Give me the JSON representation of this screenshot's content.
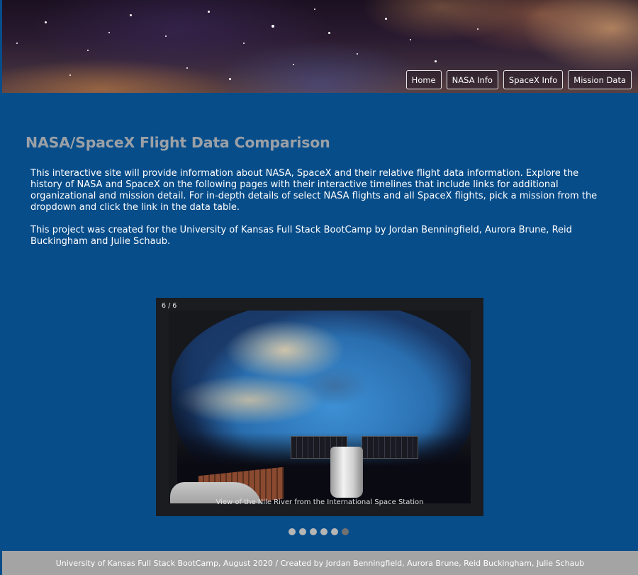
{
  "nav": {
    "items": [
      {
        "label": "Home"
      },
      {
        "label": "NASA Info"
      },
      {
        "label": "SpaceX Info"
      },
      {
        "label": "Mission Data"
      }
    ]
  },
  "main": {
    "title": "NASA/SpaceX Flight Data Comparison",
    "paragraphs": [
      "This interactive site will provide information about NASA, SpaceX and their relative flight data information. Explore the history of NASA and SpaceX on the following pages with their interactive timelines that include links for additional organizational and mission detail. For in-depth details of select NASA flights and all SpaceX flights, pick a mission from the dropdown and click the link in the data table.",
      "This project was created for the University of Kansas Full Stack BootCamp by Jordan Benningfield, Aurora Brune, Reid Buckingham and Julie Schaub."
    ]
  },
  "carousel": {
    "counter": "6 / 6",
    "caption": "View of the Nile River from the International Space Station",
    "slide_count": 6,
    "active_index": 6
  },
  "footer": {
    "text": "University of Kansas Full Stack BootCamp, August 2020 / Created by Jordan Benningfield, Aurora Brune, Reid Buckingham, Julie Schaub"
  }
}
